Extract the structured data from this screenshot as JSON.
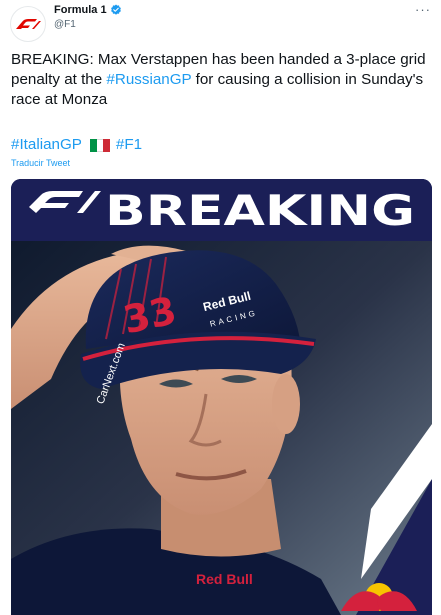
{
  "account": {
    "display_name": "Formula 1",
    "handle": "@F1",
    "avatar_icon": "f1-logo-icon",
    "verified_icon": "verified-badge-icon"
  },
  "menu_icon_glyph": "···",
  "tweet": {
    "text_before": "BREAKING: Max Verstappen has been handed a 3-place grid penalty at the ",
    "hashtag_inline": "#RussianGP",
    "text_after": " for causing a collision in Sunday's race at Monza",
    "hashtag_1": "#ItalianGP",
    "flag_icon": "italy-flag-icon",
    "hashtag_2": "#F1",
    "translate_label": "Traducir Tweet"
  },
  "media": {
    "banner_text": "BREAKING",
    "cap_number": "33",
    "cap_sponsor_1": "Red Bull",
    "cap_sponsor_1_sub": "RACING",
    "cap_sponsor_2": "CarNext.com",
    "shirt_sponsor": "Red Bull"
  },
  "colors": {
    "f1_red": "#e10600",
    "link_blue": "#1d9bf0",
    "banner_navy": "#1b1f57",
    "banner_white": "#ffffff"
  }
}
